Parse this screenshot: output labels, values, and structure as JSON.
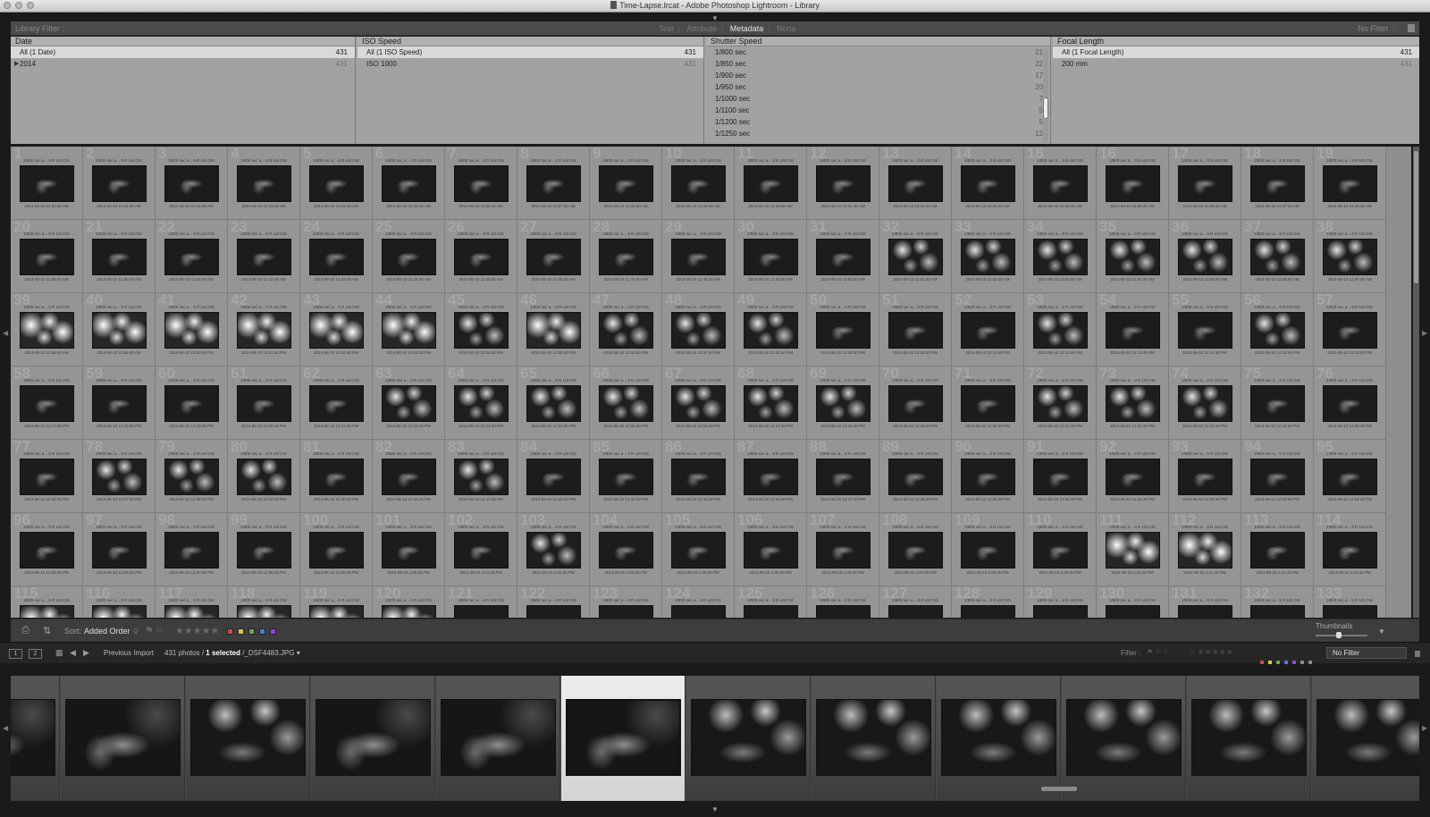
{
  "window": {
    "title": "Time-Lapse.lrcat - Adobe Photoshop Lightroom - Library"
  },
  "library_filter": {
    "label": "Library Filter :",
    "tabs": [
      "Text",
      "Attribute",
      "Metadata",
      "None"
    ],
    "active_tab": "Metadata",
    "preset": "No Filter ♢"
  },
  "metadata_columns": {
    "date": {
      "header": "Date",
      "rows": [
        {
          "label": "All (1 Date)",
          "count": "431"
        },
        {
          "label": "2014",
          "count": "431"
        }
      ]
    },
    "iso": {
      "header": "ISO Speed",
      "rows": [
        {
          "label": "All (1 ISO Speed)",
          "count": "431"
        },
        {
          "label": "ISO 1000",
          "count": "431"
        }
      ]
    },
    "shutter": {
      "header": "Shutter Speed",
      "rows": [
        {
          "label": "1/800 sec",
          "count": "21"
        },
        {
          "label": "1/850 sec",
          "count": "22"
        },
        {
          "label": "1/900 sec",
          "count": "17"
        },
        {
          "label": "1/950 sec",
          "count": "20"
        },
        {
          "label": "1/1000 sec",
          "count": "7"
        },
        {
          "label": "1/1100 sec",
          "count": "5"
        },
        {
          "label": "1/1200 sec",
          "count": "5"
        },
        {
          "label": "1/1250 sec",
          "count": "12"
        }
      ]
    },
    "focal": {
      "header": "Focal Length",
      "rows": [
        {
          "label": "All (1 Focal Length)",
          "count": "431"
        },
        {
          "label": "200 mm",
          "count": "431"
        }
      ]
    }
  },
  "grid": {
    "meta_text": "1/800 sec a... 8 R LM OIS",
    "cells": [
      {
        "n": "1",
        "time": "2014-06-10 11:20:40 AM",
        "t": "l"
      },
      {
        "n": "2",
        "time": "2014-06-10 11:21:40 AM",
        "t": "l"
      },
      {
        "n": "3",
        "time": "2014-06-10 11:22:40 AM",
        "t": "l"
      },
      {
        "n": "4",
        "time": "2014-06-10 11:23:40 AM",
        "t": "l"
      },
      {
        "n": "5",
        "time": "2014-06-10 11:24:40 AM",
        "t": "l"
      },
      {
        "n": "6",
        "time": "2014-06-10 11:25:40 AM",
        "t": "l"
      },
      {
        "n": "7",
        "time": "2014-06-10 11:26:40 AM",
        "t": "l"
      },
      {
        "n": "8",
        "time": "2014-06-10 11:27:40 AM",
        "t": "l"
      },
      {
        "n": "9",
        "time": "2014-06-10 11:28:40 AM",
        "t": "l"
      },
      {
        "n": "10",
        "time": "2014-06-10 11:29:40 AM",
        "t": "l"
      },
      {
        "n": "11",
        "time": "2014-06-10 11:30:40 AM",
        "t": "l"
      },
      {
        "n": "12",
        "time": "2014-06-10 11:31:40 AM",
        "t": "l"
      },
      {
        "n": "13",
        "time": "2014-06-10 11:32:40 AM",
        "t": "l"
      },
      {
        "n": "14",
        "time": "2014-06-10 11:33:40 AM",
        "t": "l"
      },
      {
        "n": "15",
        "time": "2014-06-10 11:34:40 AM",
        "t": "l"
      },
      {
        "n": "16",
        "time": "2014-06-10 11:35:40 AM",
        "t": "l"
      },
      {
        "n": "17",
        "time": "2014-06-10 11:36:40 AM",
        "t": "l"
      },
      {
        "n": "18",
        "time": "2014-06-10 11:37:40 AM",
        "t": "l"
      },
      {
        "n": "19",
        "time": "2014-06-10 11:38:40 AM",
        "t": "l"
      },
      {
        "n": "20",
        "time": "2014-06-10 11:39:40 AM",
        "t": "l"
      },
      {
        "n": "21",
        "time": "2014-06-10 11:40:40 AM",
        "t": "l"
      },
      {
        "n": "22",
        "time": "2014-06-10 11:41:40 AM",
        "t": "l"
      },
      {
        "n": "23",
        "time": "2014-06-10 11:42:40 AM",
        "t": "l"
      },
      {
        "n": "24",
        "time": "2014-06-10 11:43:40 AM",
        "t": "l"
      },
      {
        "n": "25",
        "time": "2014-06-10 11:44:40 AM",
        "t": "l"
      },
      {
        "n": "26",
        "time": "2014-06-10 11:45:40 AM",
        "t": "l"
      },
      {
        "n": "27",
        "time": "2014-06-10 11:46:40 AM",
        "t": "l"
      },
      {
        "n": "28",
        "time": "2014-06-10 11:47:40 AM",
        "t": "l"
      },
      {
        "n": "29",
        "time": "2014-06-10 11:48:40 AM",
        "t": "l"
      },
      {
        "n": "30",
        "time": "2014-06-10 11:49:40 AM",
        "t": "l"
      },
      {
        "n": "31",
        "time": "2014-06-10 11:50:40 AM",
        "t": "l"
      },
      {
        "n": "32",
        "time": "2014-06-10 11:51:40 AM",
        "t": "b"
      },
      {
        "n": "33",
        "time": "2014-06-10 11:52:40 AM",
        "t": "b"
      },
      {
        "n": "34",
        "time": "2014-06-10 11:53:40 AM",
        "t": "b"
      },
      {
        "n": "35",
        "time": "2014-06-10 11:54:40 AM",
        "t": "b"
      },
      {
        "n": "36",
        "time": "2014-06-10 11:55:40 AM",
        "t": "b"
      },
      {
        "n": "37",
        "time": "2014-06-10 11:56:40 AM",
        "t": "b"
      },
      {
        "n": "38",
        "time": "2014-06-10 11:57:40 AM",
        "t": "b"
      },
      {
        "n": "39",
        "time": "2014-06-10 11:58:40 AM",
        "t": "w"
      },
      {
        "n": "40",
        "time": "2014-06-10 11:59:40 AM",
        "t": "w"
      },
      {
        "n": "41",
        "time": "2014-06-10 12:00:40 PM",
        "t": "w"
      },
      {
        "n": "42",
        "time": "2014-06-10 12:01:40 PM",
        "t": "w"
      },
      {
        "n": "43",
        "time": "2014-06-10 12:02:40 PM",
        "t": "w"
      },
      {
        "n": "44",
        "time": "2014-06-10 12:03:40 PM",
        "t": "w"
      },
      {
        "n": "45",
        "time": "2014-06-10 12:04:40 PM",
        "t": "b"
      },
      {
        "n": "46",
        "time": "2014-06-10 12:05:40 PM",
        "t": "w"
      },
      {
        "n": "47",
        "time": "2014-06-10 12:06:40 PM",
        "t": "b"
      },
      {
        "n": "48",
        "time": "2014-06-10 12:07:40 PM",
        "t": "b"
      },
      {
        "n": "49",
        "time": "2014-06-10 12:08:40 PM",
        "t": "b"
      },
      {
        "n": "50",
        "time": "2014-06-10 12:09:40 PM",
        "t": "l"
      },
      {
        "n": "51",
        "time": "2014-06-10 12:10:40 PM",
        "t": "l"
      },
      {
        "n": "52",
        "time": "2014-06-10 12:11:40 PM",
        "t": "l"
      },
      {
        "n": "53",
        "time": "2014-06-10 12:12:40 PM",
        "t": "b"
      },
      {
        "n": "54",
        "time": "2014-06-10 12:13:40 PM",
        "t": "l"
      },
      {
        "n": "55",
        "time": "2014-06-10 12:14:40 PM",
        "t": "l"
      },
      {
        "n": "56",
        "time": "2014-06-10 12:15:40 PM",
        "t": "b"
      },
      {
        "n": "57",
        "time": "2014-06-10 12:16:40 PM",
        "t": "l"
      },
      {
        "n": "58",
        "time": "2014-06-10 12:17:40 PM",
        "t": "l"
      },
      {
        "n": "59",
        "time": "2014-06-10 12:18:40 PM",
        "t": "l"
      },
      {
        "n": "60",
        "time": "2014-06-10 12:19:40 PM",
        "t": "l"
      },
      {
        "n": "61",
        "time": "2014-06-10 12:20:40 PM",
        "t": "l"
      },
      {
        "n": "62",
        "time": "2014-06-10 12:21:40 PM",
        "t": "l"
      },
      {
        "n": "63",
        "time": "2014-06-10 12:22:40 PM",
        "t": "b"
      },
      {
        "n": "64",
        "time": "2014-06-10 12:23:40 PM",
        "t": "b"
      },
      {
        "n": "65",
        "time": "2014-06-10 12:24:40 PM",
        "t": "b"
      },
      {
        "n": "66",
        "time": "2014-06-10 12:25:40 PM",
        "t": "b"
      },
      {
        "n": "67",
        "time": "2014-06-10 12:26:40 PM",
        "t": "b"
      },
      {
        "n": "68",
        "time": "2014-06-10 12:27:40 PM",
        "t": "b"
      },
      {
        "n": "69",
        "time": "2014-06-10 12:28:40 PM",
        "t": "b"
      },
      {
        "n": "70",
        "time": "2014-06-10 12:29:40 PM",
        "t": "l"
      },
      {
        "n": "71",
        "time": "2014-06-10 12:30:40 PM",
        "t": "l"
      },
      {
        "n": "72",
        "time": "2014-06-10 12:31:40 PM",
        "t": "b"
      },
      {
        "n": "73",
        "time": "2014-06-10 12:32:40 PM",
        "t": "b"
      },
      {
        "n": "74",
        "time": "2014-06-10 12:33:40 PM",
        "t": "b"
      },
      {
        "n": "75",
        "time": "2014-06-10 12:34:40 PM",
        "t": "l"
      },
      {
        "n": "76",
        "time": "2014-06-10 12:35:40 PM",
        "t": "l"
      },
      {
        "n": "77",
        "time": "2014-06-10 12:36:40 PM",
        "t": "l"
      },
      {
        "n": "78",
        "time": "2014-06-10 12:37:40 PM",
        "t": "b"
      },
      {
        "n": "79",
        "time": "2014-06-10 12:38:40 PM",
        "t": "b"
      },
      {
        "n": "80",
        "time": "2014-06-10 12:39:40 PM",
        "t": "b"
      },
      {
        "n": "81",
        "time": "2014-06-10 12:40:40 PM",
        "t": "l"
      },
      {
        "n": "82",
        "time": "2014-06-10 12:41:40 PM",
        "t": "l"
      },
      {
        "n": "83",
        "time": "2014-06-10 12:42:40 PM",
        "t": "b"
      },
      {
        "n": "84",
        "time": "2014-06-10 12:43:40 PM",
        "t": "l"
      },
      {
        "n": "85",
        "time": "2014-06-10 12:44:40 PM",
        "t": "l"
      },
      {
        "n": "86",
        "time": "2014-06-10 12:45:40 PM",
        "t": "l"
      },
      {
        "n": "87",
        "time": "2014-06-10 12:46:40 PM",
        "t": "l"
      },
      {
        "n": "88",
        "time": "2014-06-10 12:47:40 PM",
        "t": "l"
      },
      {
        "n": "89",
        "time": "2014-06-10 12:48:40 PM",
        "t": "l"
      },
      {
        "n": "90",
        "time": "2014-06-10 12:49:40 PM",
        "t": "l"
      },
      {
        "n": "91",
        "time": "2014-06-10 12:50:40 PM",
        "t": "l"
      },
      {
        "n": "92",
        "time": "2014-06-10 12:51:40 PM",
        "t": "l"
      },
      {
        "n": "93",
        "time": "2014-06-10 12:52:40 PM",
        "t": "l"
      },
      {
        "n": "94",
        "time": "2014-06-10 12:53:40 PM",
        "t": "l"
      },
      {
        "n": "95",
        "time": "2014-06-10 12:54:40 PM",
        "t": "l"
      },
      {
        "n": "96",
        "time": "2014-06-10 12:55:40 PM",
        "t": "l"
      },
      {
        "n": "97",
        "time": "2014-06-10 12:56:40 PM",
        "t": "l"
      },
      {
        "n": "98",
        "time": "2014-06-10 12:57:40 PM",
        "t": "l"
      },
      {
        "n": "99",
        "time": "2014-06-10 12:58:40 PM",
        "t": "l"
      },
      {
        "n": "100",
        "time": "2014-06-10 12:59:40 PM",
        "t": "l"
      },
      {
        "n": "101",
        "time": "2014-06-10 1:00:40 PM",
        "t": "l"
      },
      {
        "n": "102",
        "time": "2014-06-10 1:01:40 PM",
        "t": "l"
      },
      {
        "n": "103",
        "time": "2014-06-10 1:02:40 PM",
        "t": "b"
      },
      {
        "n": "104",
        "time": "2014-06-10 1:03:40 PM",
        "t": "l"
      },
      {
        "n": "105",
        "time": "2014-06-10 1:04:40 PM",
        "t": "l"
      },
      {
        "n": "106",
        "time": "2014-06-10 1:05:40 PM",
        "t": "l"
      },
      {
        "n": "107",
        "time": "2014-06-10 1:06:40 PM",
        "t": "l"
      },
      {
        "n": "108",
        "time": "2014-06-10 1:07:40 PM",
        "t": "l"
      },
      {
        "n": "109",
        "time": "2014-06-10 1:08:40 PM",
        "t": "l"
      },
      {
        "n": "110",
        "time": "2014-06-10 1:09:40 PM",
        "t": "l"
      },
      {
        "n": "111",
        "time": "2014-06-10 1:10:40 PM",
        "t": "w"
      },
      {
        "n": "112",
        "time": "2014-06-10 1:11:40 PM",
        "t": "w"
      },
      {
        "n": "113",
        "time": "2014-06-10 1:12:40 PM",
        "t": "l"
      },
      {
        "n": "114",
        "time": "2014-06-10 1:13:40 PM",
        "t": "l"
      },
      {
        "n": "115",
        "time": "",
        "t": "w"
      },
      {
        "n": "116",
        "time": "",
        "t": "w"
      },
      {
        "n": "117",
        "time": "",
        "t": "w"
      },
      {
        "n": "118",
        "time": "",
        "t": "w"
      },
      {
        "n": "119",
        "time": "",
        "t": "w"
      },
      {
        "n": "120",
        "time": "",
        "t": "w"
      },
      {
        "n": "121",
        "time": "",
        "t": "l"
      },
      {
        "n": "122",
        "time": "",
        "t": "l"
      },
      {
        "n": "123",
        "time": "",
        "t": "l"
      },
      {
        "n": "124",
        "time": "",
        "t": "l"
      },
      {
        "n": "125",
        "time": "",
        "t": "l"
      },
      {
        "n": "126",
        "time": "",
        "t": "l"
      },
      {
        "n": "127",
        "time": "",
        "t": "l"
      },
      {
        "n": "128",
        "time": "",
        "t": "l"
      },
      {
        "n": "129",
        "time": "",
        "t": "l"
      },
      {
        "n": "130",
        "time": "",
        "t": "l"
      },
      {
        "n": "131",
        "time": "",
        "t": "l"
      },
      {
        "n": "132",
        "time": "",
        "t": "l"
      },
      {
        "n": "133",
        "time": "",
        "t": "l"
      }
    ]
  },
  "toolbar": {
    "sort_label": "Sort:",
    "sort_value": "Added Order ♢",
    "color_labels": [
      "#d24a4a",
      "#d8c84a",
      "#5fae4a",
      "#4a7fd2",
      "#8a4ad2"
    ],
    "thumbnails_label": "Thumbnails",
    "thumbnail_size": 0.45
  },
  "filmstrip_header": {
    "screen1": "1",
    "screen2": "2",
    "source": "Previous Import",
    "count_prefix": "431 photos /",
    "selected": "1 selected",
    "file": "/_DSF4483.JPG ▾",
    "filter_label": "Filter :",
    "filter_value": "No Filter"
  },
  "filmstrip": {
    "frames": [
      "l",
      "l",
      "b",
      "l",
      "l",
      "l",
      "b",
      "b",
      "b",
      "b",
      "b",
      "b"
    ],
    "selected_index": 5
  }
}
